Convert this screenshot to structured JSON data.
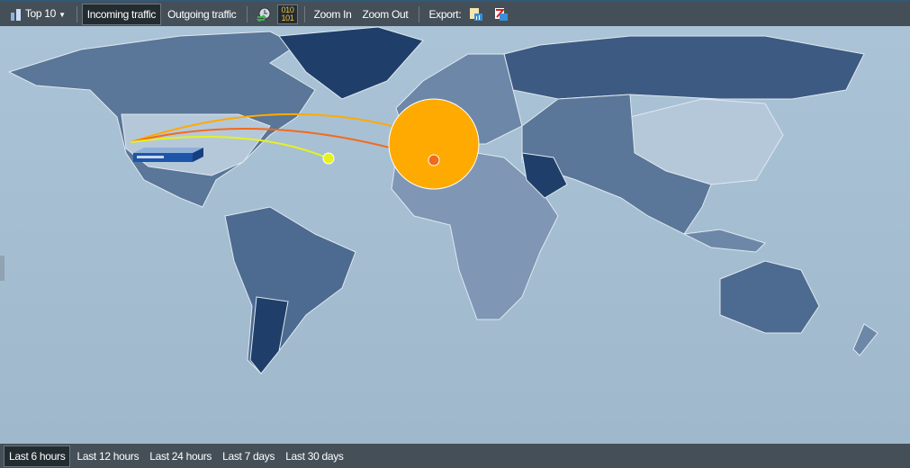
{
  "toolbar": {
    "top_label": "Top 10",
    "incoming": "Incoming traffic",
    "outgoing": "Outgoing traffic",
    "binary_top": "010",
    "binary_bottom": "101",
    "zoom_in": "Zoom In",
    "zoom_out": "Zoom Out",
    "export": "Export:"
  },
  "time_ranges": [
    "Last 6 hours",
    "Last 12 hours",
    "Last 24 hours",
    "Last 7 days",
    "Last 30 days"
  ],
  "selected_time_range": "Last 6 hours",
  "colors": {
    "toolbar": "#454f58",
    "ocean": "#a6bfd2",
    "land_dark": "#1f3f6a",
    "land_light": "#b5c8da",
    "flow_orange": "#ffaa00",
    "flow_red": "#f26a1b",
    "flow_yellow": "#e6f21e"
  }
}
